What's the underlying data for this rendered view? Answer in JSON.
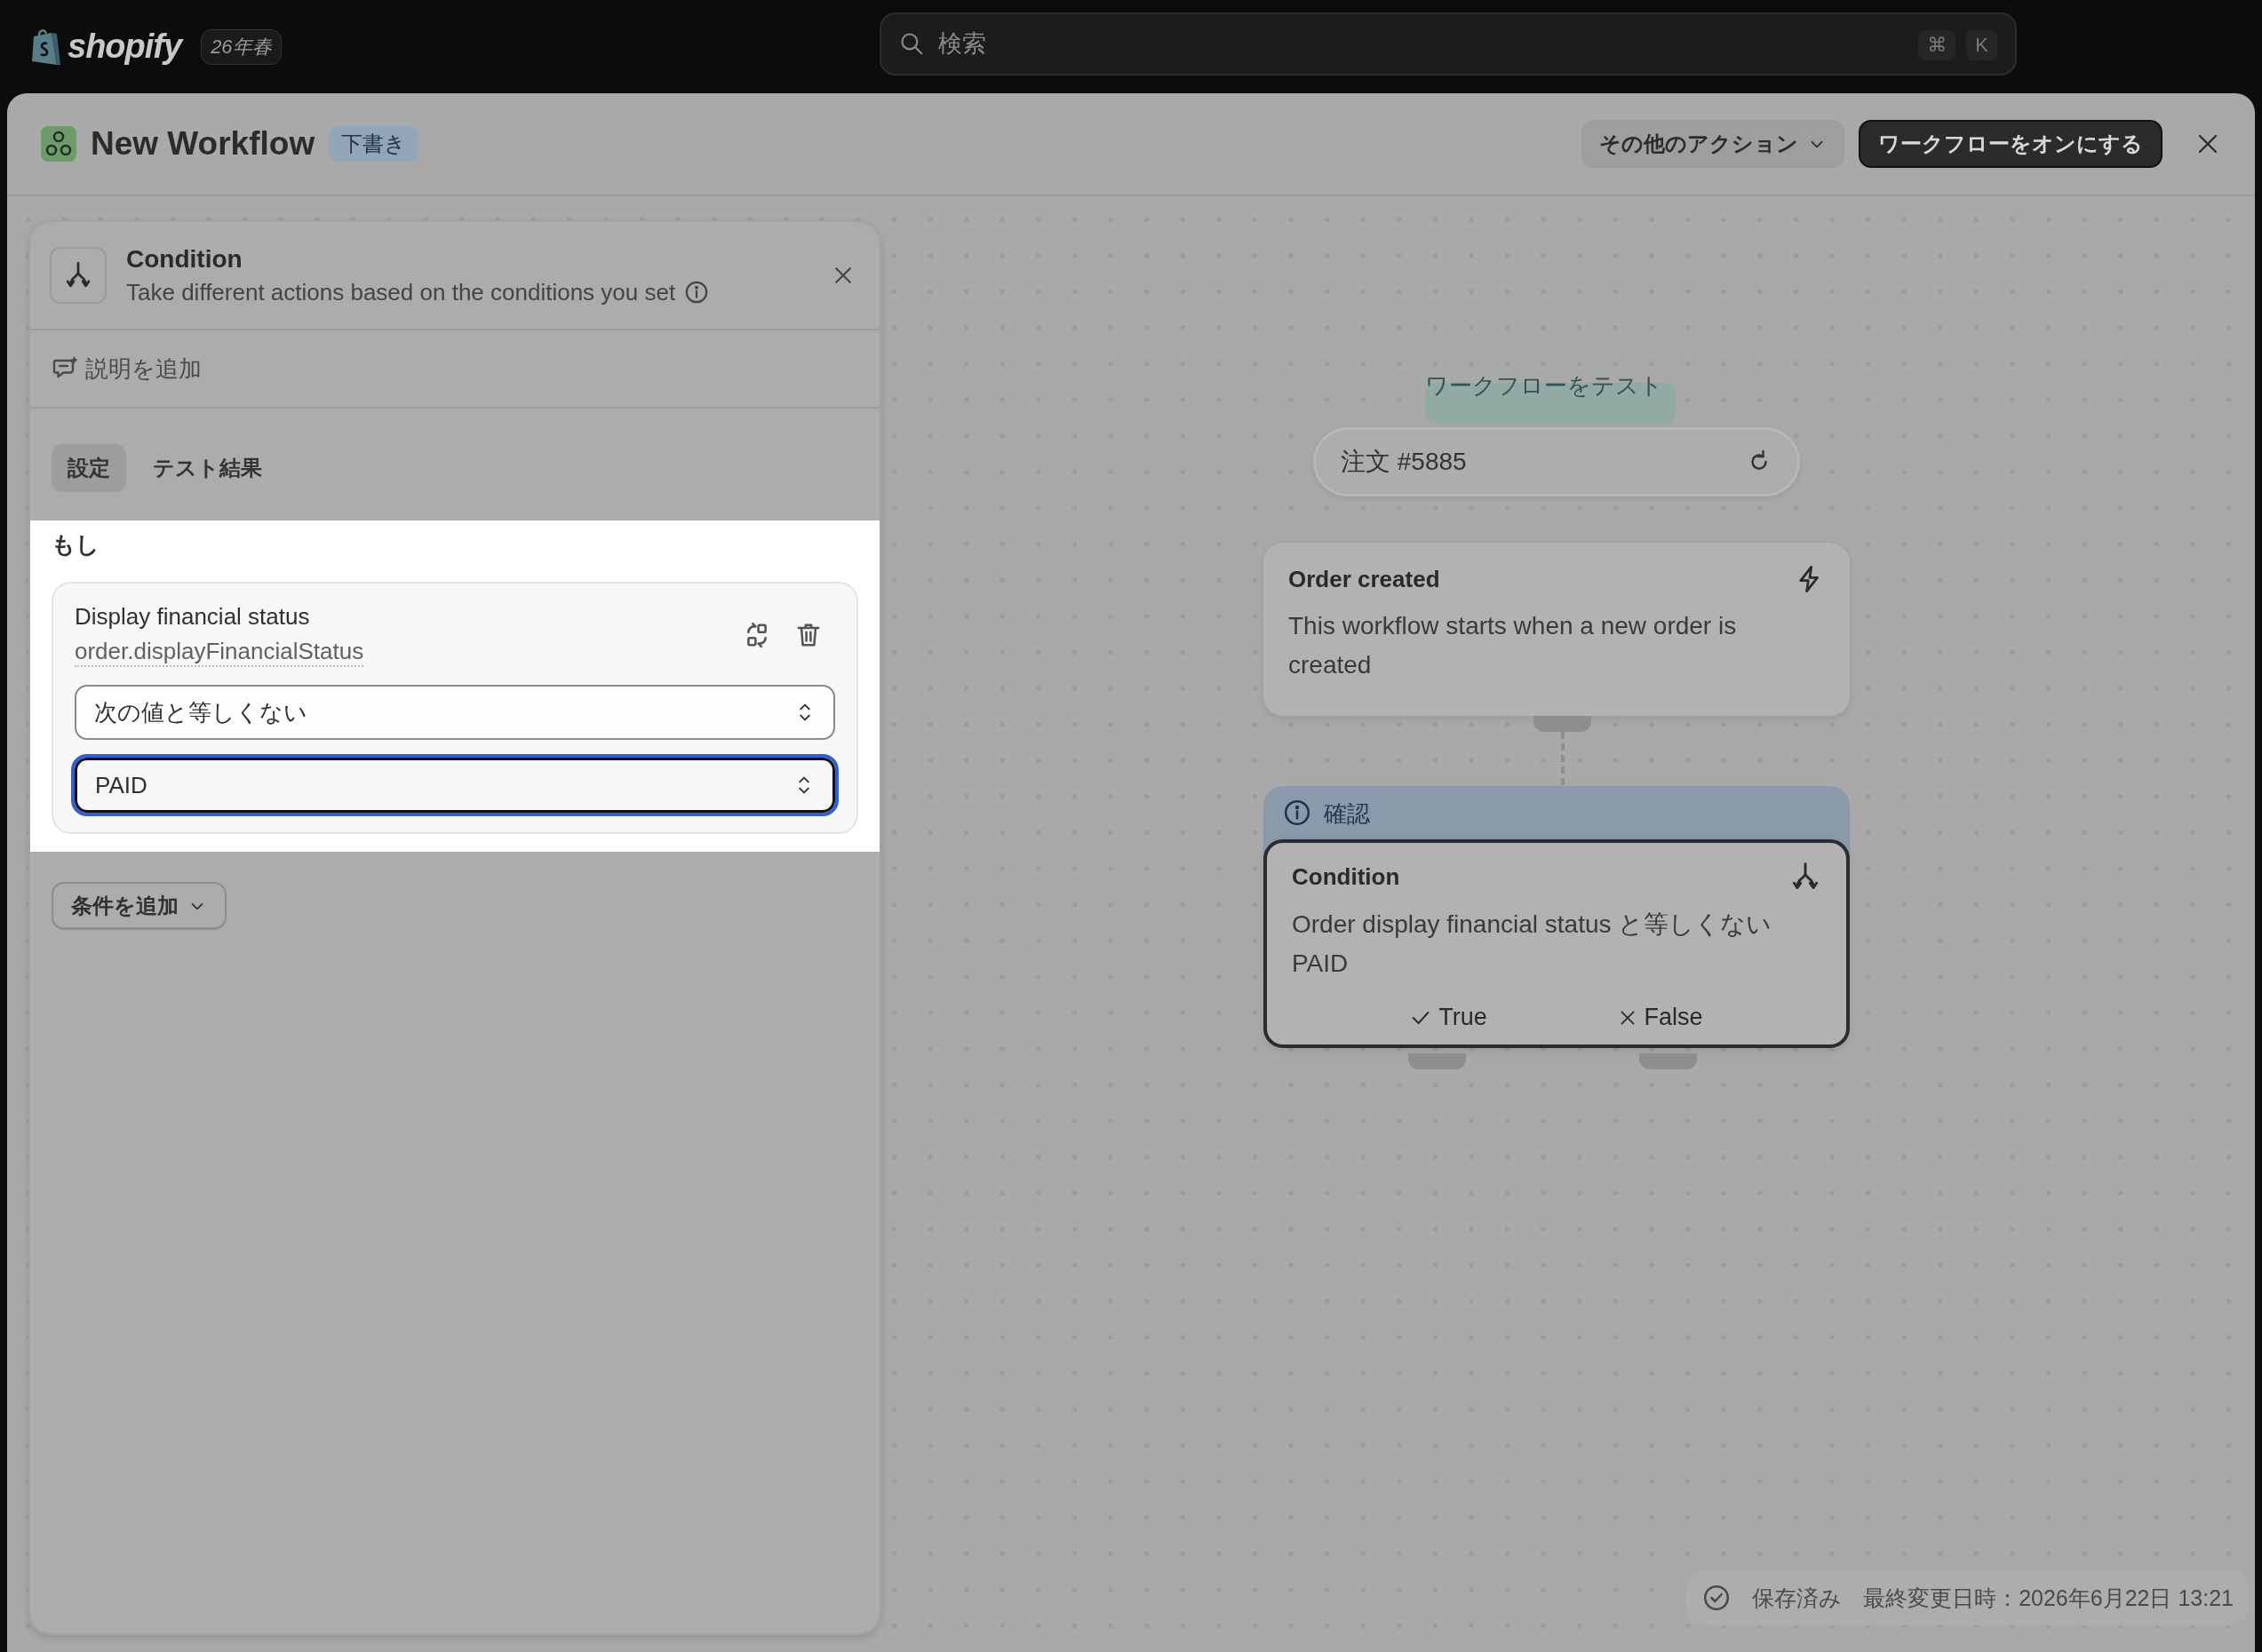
{
  "top_bar": {
    "logo_text": "shopify",
    "edition_badge": "26年春",
    "search": {
      "placeholder": "検索"
    },
    "shortcut_keys": [
      "⌘",
      "K"
    ]
  },
  "window": {
    "title": "New Workflow",
    "status_badge": "下書き",
    "actions": [
      {
        "label": "その他のアクション",
        "kind": "menu"
      },
      {
        "label": "ワークフローをオンにする",
        "kind": "primary"
      }
    ]
  },
  "panel": {
    "title": "Condition",
    "subtitle": "Take different actions based on the conditions you set",
    "add_description": "説明を追加",
    "tabs": [
      {
        "label": "設定",
        "selected": true
      },
      {
        "label": "テスト結果",
        "selected": false
      }
    ],
    "section_label": "もし",
    "conditions": [
      {
        "name": "Display financial status",
        "path": "order.displayFinancialStatus",
        "fields": [
          {
            "value": "次の値と等しくない",
            "focused": false
          },
          {
            "value": "PAID",
            "focused": true
          }
        ]
      }
    ],
    "add_condition": "条件を追加"
  },
  "canvas": {
    "test_label": "ワークフローをテスト",
    "test_order": "注文 #5885",
    "nodes": [
      {
        "kind": "trigger",
        "title": "Order created",
        "description": "This workflow starts when a new order is created",
        "selected": false
      },
      {
        "kind": "condition",
        "banner": "確認",
        "title": "Condition",
        "description": "Order display financial status と等しくない PAID",
        "selected": true,
        "branches": [
          {
            "label": "True",
            "kind": "check"
          },
          {
            "label": "False",
            "kind": "cross"
          }
        ]
      }
    ]
  },
  "status_bar": {
    "saved": "保存済み",
    "last_modified": "最終変更日時：2026年6月22日 13:21"
  }
}
